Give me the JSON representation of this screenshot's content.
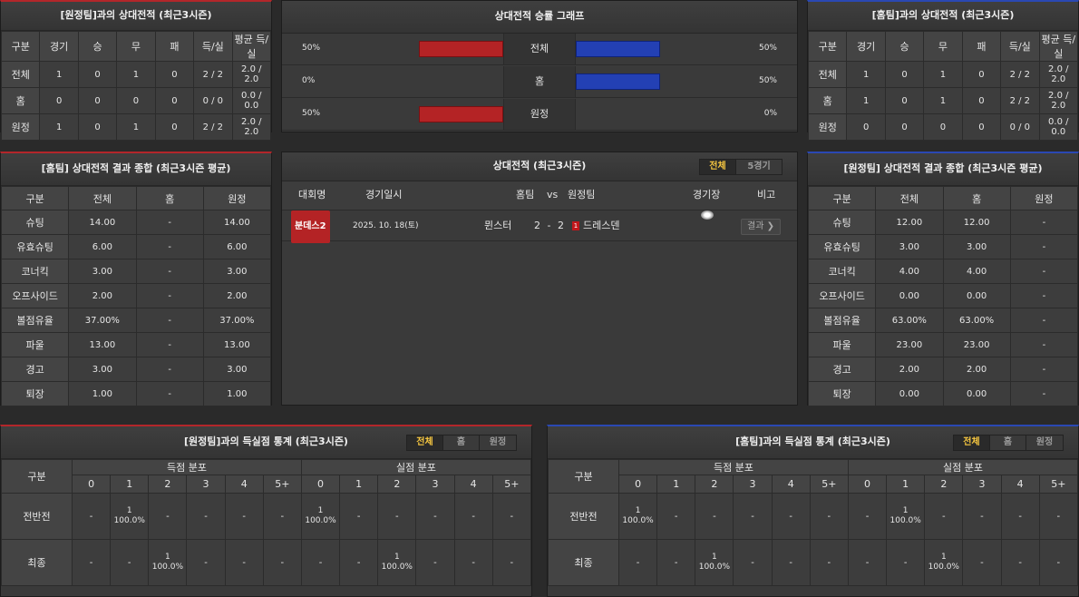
{
  "away_h2h": {
    "title": "[원정팀]과의 상대전적 (최근3시즌)",
    "headers": [
      "구분",
      "경기",
      "승",
      "무",
      "패",
      "득/실",
      "평균 득/실"
    ],
    "rows": [
      [
        "전체",
        "1",
        "0",
        "1",
        "0",
        "2 / 2",
        "2.0 / 2.0"
      ],
      [
        "홈",
        "0",
        "0",
        "0",
        "0",
        "0 / 0",
        "0.0 / 0.0"
      ],
      [
        "원정",
        "1",
        "0",
        "1",
        "0",
        "2 / 2",
        "2.0 / 2.0"
      ]
    ]
  },
  "graph": {
    "title": "상대전적 승률 그래프",
    "rows": [
      {
        "label": "전체",
        "left": "50%",
        "right": "50%",
        "left_val": 0.5,
        "right_val": 0.5
      },
      {
        "label": "홈",
        "left": "0%",
        "right": "50%",
        "left_val": 0,
        "right_val": 0.5
      },
      {
        "label": "원정",
        "left": "50%",
        "right": "0%",
        "left_val": 0.5,
        "right_val": 0
      }
    ]
  },
  "home_h2h": {
    "title": "[홈팀]과의 상대전적 (최근3시즌)",
    "headers": [
      "구분",
      "경기",
      "승",
      "무",
      "패",
      "득/실",
      "평균 득/실"
    ],
    "rows": [
      [
        "전체",
        "1",
        "0",
        "1",
        "0",
        "2 / 2",
        "2.0 / 2.0"
      ],
      [
        "홈",
        "1",
        "0",
        "1",
        "0",
        "2 / 2",
        "2.0 / 2.0"
      ],
      [
        "원정",
        "0",
        "0",
        "0",
        "0",
        "0 / 0",
        "0.0 / 0.0"
      ]
    ]
  },
  "home_summary": {
    "title": "[홈팀] 상대전적 결과 종합 (최근3시즌 평균)",
    "headers": [
      "구분",
      "전체",
      "홈",
      "원정"
    ],
    "rows": [
      [
        "슈팅",
        "14.00",
        "-",
        "14.00"
      ],
      [
        "유효슈팅",
        "6.00",
        "-",
        "6.00"
      ],
      [
        "코너킥",
        "3.00",
        "-",
        "3.00"
      ],
      [
        "오프사이드",
        "2.00",
        "-",
        "2.00"
      ],
      [
        "볼점유율",
        "37.00%",
        "-",
        "37.00%"
      ],
      [
        "파울",
        "13.00",
        "-",
        "13.00"
      ],
      [
        "경고",
        "3.00",
        "-",
        "3.00"
      ],
      [
        "퇴장",
        "1.00",
        "-",
        "1.00"
      ]
    ]
  },
  "matches": {
    "title": "상대전적 (최근3시즌)",
    "tabs": [
      "전체",
      "5경기"
    ],
    "headers": {
      "league": "대회명",
      "date": "경기일시",
      "home": "홈팀",
      "vs": "vs",
      "away": "원정팀",
      "stadium": "경기장",
      "note": "비고"
    },
    "rows": [
      {
        "league": "분데스2",
        "date": "2025. 10. 18(토)",
        "home": "뮌스터",
        "score": "2 - 2",
        "red": "1",
        "away": "드레스덴",
        "result": "결과 ❯"
      }
    ]
  },
  "away_summary": {
    "title": "[원정팀] 상대전적 결과 종합 (최근3시즌 평균)",
    "headers": [
      "구분",
      "전체",
      "홈",
      "원정"
    ],
    "rows": [
      [
        "슈팅",
        "12.00",
        "12.00",
        "-"
      ],
      [
        "유효슈팅",
        "3.00",
        "3.00",
        "-"
      ],
      [
        "코너킥",
        "4.00",
        "4.00",
        "-"
      ],
      [
        "오프사이드",
        "0.00",
        "0.00",
        "-"
      ],
      [
        "볼점유율",
        "63.00%",
        "63.00%",
        "-"
      ],
      [
        "파울",
        "23.00",
        "23.00",
        "-"
      ],
      [
        "경고",
        "2.00",
        "2.00",
        "-"
      ],
      [
        "퇴장",
        "0.00",
        "0.00",
        "-"
      ]
    ]
  },
  "away_goals": {
    "title": "[원정팀]과의 득실점 통계 (최근3시즌)",
    "tabs": [
      "전체",
      "홈",
      "원정"
    ],
    "group_label": "구분",
    "scored": "득점 분포",
    "conceded": "실점 분포",
    "cols": [
      "0",
      "1",
      "2",
      "3",
      "4",
      "5+"
    ],
    "rows": [
      {
        "label": "전반전",
        "scored": [
          "-",
          "1|100.0%",
          "-",
          "-",
          "-",
          "-"
        ],
        "conceded": [
          "1|100.0%",
          "-",
          "-",
          "-",
          "-",
          "-"
        ]
      },
      {
        "label": "최종",
        "scored": [
          "-",
          "-",
          "1|100.0%",
          "-",
          "-",
          "-"
        ],
        "conceded": [
          "-",
          "-",
          "1|100.0%",
          "-",
          "-",
          "-"
        ]
      }
    ]
  },
  "home_goals": {
    "title": "[홈팀]과의 득실점 통계 (최근3시즌)",
    "tabs": [
      "전체",
      "홈",
      "원정"
    ],
    "group_label": "구분",
    "scored": "득점 분포",
    "conceded": "실점 분포",
    "cols": [
      "0",
      "1",
      "2",
      "3",
      "4",
      "5+"
    ],
    "rows": [
      {
        "label": "전반전",
        "scored": [
          "1|100.0%",
          "-",
          "-",
          "-",
          "-",
          "-"
        ],
        "conceded": [
          "-",
          "1|100.0%",
          "-",
          "-",
          "-",
          "-"
        ]
      },
      {
        "label": "최종",
        "scored": [
          "-",
          "-",
          "1|100.0%",
          "-",
          "-",
          "-"
        ],
        "conceded": [
          "-",
          "-",
          "1|100.0%",
          "-",
          "-",
          "-"
        ]
      }
    ]
  },
  "colors": {
    "home_accent": "#b3262a",
    "away_accent": "#2a48b3",
    "tab_active": "#f7c740"
  }
}
